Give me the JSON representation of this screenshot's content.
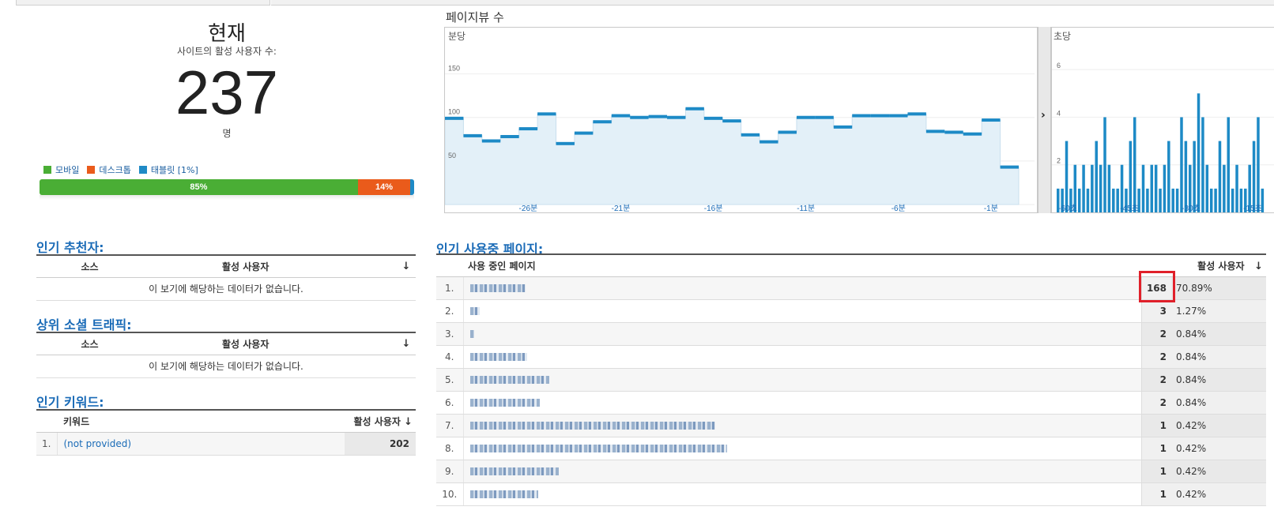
{
  "summary": {
    "title": "현재",
    "subtitle": "사이트의 활성 사용자 수:",
    "count": "237",
    "unit": "명"
  },
  "devices": {
    "legend": [
      {
        "label": "모바일",
        "color": "#4aae35"
      },
      {
        "label": "데스크톱",
        "color": "#ea5b1b"
      },
      {
        "label": "태블릿 [1%]",
        "color": "#1f8ac6"
      }
    ],
    "segments": [
      {
        "label": "85%",
        "share": 85,
        "color": "#4aae35"
      },
      {
        "label": "14%",
        "share": 14,
        "color": "#ea5b1b"
      },
      {
        "label": "",
        "share": 1,
        "color": "#1f8ac6"
      }
    ]
  },
  "pageviews": {
    "title": "페이지뷰 수",
    "per_minute_label": "분당",
    "per_second_label": "초당",
    "expand_arrow": "›"
  },
  "chart_data": [
    {
      "type": "bar",
      "title": "분당",
      "x": [
        -30,
        -29,
        -28,
        -27,
        -26,
        -25,
        -24,
        -23,
        -22,
        -21,
        -20,
        -19,
        -18,
        -17,
        -16,
        -15,
        -14,
        -13,
        -12,
        -11,
        -10,
        -9,
        -8,
        -7,
        -6,
        -5,
        -4,
        -3,
        -2,
        -1
      ],
      "values": [
        99,
        79,
        73,
        78,
        87,
        104,
        70,
        82,
        95,
        102,
        100,
        101,
        100,
        110,
        99,
        96,
        80,
        72,
        83,
        100,
        100,
        89,
        102,
        102,
        102,
        104,
        84,
        83,
        81,
        97,
        43
      ],
      "xtick_labels": [
        "-26분",
        "-21분",
        "-16분",
        "-11분",
        "-6분",
        "-1분"
      ],
      "ytick_labels": [
        "50",
        "100",
        "150"
      ],
      "ylim": [
        0,
        185
      ]
    },
    {
      "type": "bar",
      "title": "초당",
      "values": [
        1,
        1,
        3,
        1,
        2,
        1,
        2,
        1,
        2,
        3,
        2,
        4,
        2,
        1,
        1,
        2,
        1,
        3,
        4,
        1,
        2,
        1,
        2,
        2,
        1,
        2,
        3,
        1,
        1,
        4,
        3,
        2,
        3,
        5,
        4,
        2,
        1,
        1,
        3,
        2,
        4,
        1,
        2,
        1,
        1,
        2,
        3,
        4,
        1
      ],
      "xtick_labels": [
        "-60초",
        "-45초",
        "-30초",
        "-15초"
      ],
      "ytick_labels": [
        "2",
        "4",
        "6"
      ],
      "ylim": [
        0,
        7.1
      ]
    }
  ],
  "referrers": {
    "heading": "인기 추천자:",
    "col_source": "소스",
    "col_active": "활성 사용자",
    "sort_icon": "↓",
    "empty": "이 보기에 해당하는 데이터가 없습니다."
  },
  "social": {
    "heading": "상위 소셜 트래픽:",
    "col_source": "소스",
    "col_active": "활성 사용자",
    "sort_icon": "↓",
    "empty": "이 보기에 해당하는 데이터가 없습니다."
  },
  "keywords": {
    "heading": "인기 키워드:",
    "col_keyword": "키워드",
    "col_active": "활성 사용자",
    "sort_icon": "↓",
    "rows": [
      {
        "num": "1.",
        "keyword": "(not provided)",
        "value": "202"
      }
    ]
  },
  "pages": {
    "heading": "인기 사용중 페이지:",
    "col_page": "사용 중인 페이지",
    "col_active": "활성 사용자",
    "sort_icon": "↓",
    "rows": [
      {
        "num": "1.",
        "value": "168",
        "pct": "70.89%",
        "blur": 70
      },
      {
        "num": "2.",
        "value": "3",
        "pct": "1.27%",
        "blur": 12
      },
      {
        "num": "3.",
        "value": "2",
        "pct": "0.84%",
        "blur": 5
      },
      {
        "num": "4.",
        "value": "2",
        "pct": "0.84%",
        "blur": 72
      },
      {
        "num": "5.",
        "value": "2",
        "pct": "0.84%",
        "blur": 100
      },
      {
        "num": "6.",
        "value": "2",
        "pct": "0.84%",
        "blur": 88
      },
      {
        "num": "7.",
        "value": "1",
        "pct": "0.42%",
        "blur": 310
      },
      {
        "num": "8.",
        "value": "1",
        "pct": "0.42%",
        "blur": 325
      },
      {
        "num": "9.",
        "value": "1",
        "pct": "0.42%",
        "blur": 112
      },
      {
        "num": "10.",
        "value": "1",
        "pct": "0.42%",
        "blur": 86
      }
    ]
  }
}
